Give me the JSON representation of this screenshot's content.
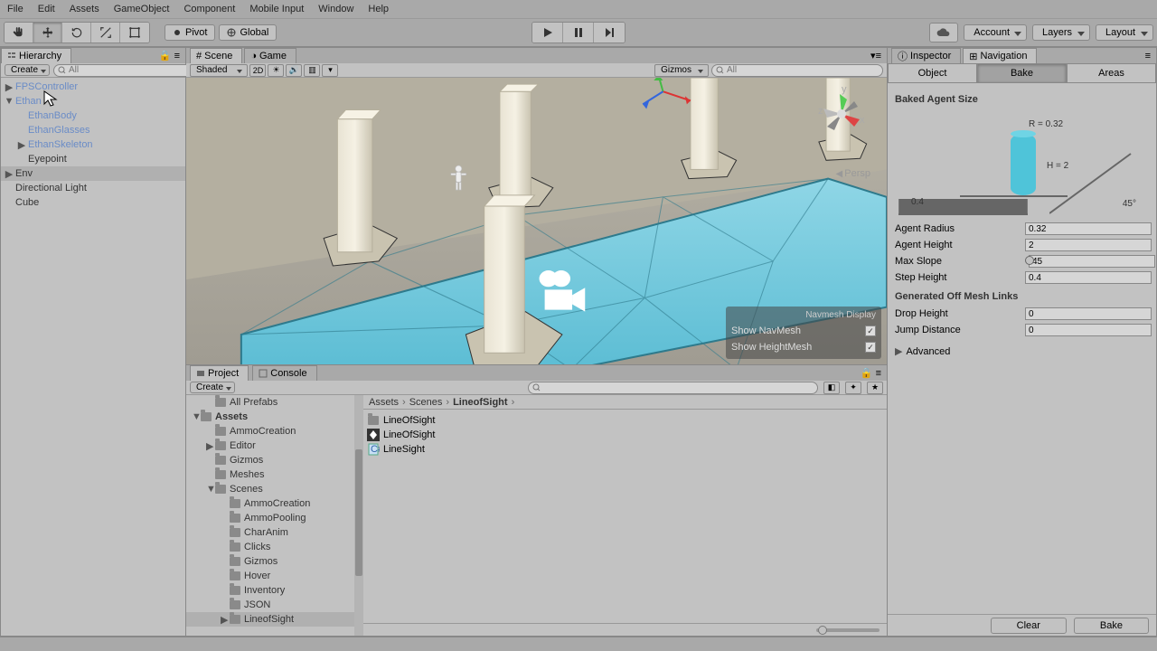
{
  "menu": {
    "items": [
      "File",
      "Edit",
      "Assets",
      "GameObject",
      "Component",
      "Mobile Input",
      "Window",
      "Help"
    ]
  },
  "toolbar": {
    "pivot": "Pivot",
    "global": "Global",
    "account": "Account",
    "layers": "Layers",
    "layout": "Layout"
  },
  "hierarchy": {
    "title": "Hierarchy",
    "create": "Create",
    "search_placeholder": "All",
    "items": [
      {
        "label": "FPSController",
        "indent": 0,
        "arrow": "▶",
        "color": "link"
      },
      {
        "label": "Ethan",
        "indent": 0,
        "arrow": "▼",
        "color": "link"
      },
      {
        "label": "EthanBody",
        "indent": 1,
        "color": "link"
      },
      {
        "label": "EthanGlasses",
        "indent": 1,
        "color": "link"
      },
      {
        "label": "EthanSkeleton",
        "indent": 1,
        "arrow": "▶",
        "color": "link"
      },
      {
        "label": "Eyepoint",
        "indent": 1,
        "plain": true
      },
      {
        "label": "Env",
        "indent": 0,
        "arrow": "▶",
        "selected": true,
        "plain": true
      },
      {
        "label": "Directional Light",
        "indent": 0,
        "plain": true
      },
      {
        "label": "Cube",
        "indent": 0,
        "plain": true
      }
    ]
  },
  "scene": {
    "tab_scene": "Scene",
    "tab_game": "Game",
    "shaded": "Shaded",
    "twod": "2D",
    "gizmos": "Gizmos",
    "search_placeholder": "All",
    "persp": "Persp",
    "navbox": {
      "title": "Navmesh Display",
      "show_navmesh": "Show NavMesh",
      "show_heightmesh": "Show HeightMesh"
    }
  },
  "project": {
    "tab_project": "Project",
    "tab_console": "Console",
    "create": "Create",
    "breadcrumb": [
      "Assets",
      "Scenes",
      "LineofSight"
    ],
    "folders": [
      {
        "label": "All Prefabs",
        "indent": 1
      },
      {
        "label": "Assets",
        "indent": 0,
        "bold": true,
        "arrow": "▼"
      },
      {
        "label": "AmmoCreation",
        "indent": 1
      },
      {
        "label": "Editor",
        "indent": 1,
        "arrow": "▶"
      },
      {
        "label": "Gizmos",
        "indent": 1
      },
      {
        "label": "Meshes",
        "indent": 1
      },
      {
        "label": "Scenes",
        "indent": 1,
        "arrow": "▼"
      },
      {
        "label": "AmmoCreation",
        "indent": 2
      },
      {
        "label": "AmmoPooling",
        "indent": 2
      },
      {
        "label": "CharAnim",
        "indent": 2
      },
      {
        "label": "Clicks",
        "indent": 2
      },
      {
        "label": "Gizmos",
        "indent": 2
      },
      {
        "label": "Hover",
        "indent": 2
      },
      {
        "label": "Inventory",
        "indent": 2
      },
      {
        "label": "JSON",
        "indent": 2
      },
      {
        "label": "LineofSight",
        "indent": 2,
        "selected": true,
        "arrow": "▶"
      }
    ],
    "assets": [
      {
        "label": "LineOfSight",
        "icon": "folder"
      },
      {
        "label": "LineOfSight",
        "icon": "unity"
      },
      {
        "label": "LineSight",
        "icon": "script"
      }
    ]
  },
  "inspector": {
    "tab_inspector": "Inspector",
    "tab_navigation": "Navigation",
    "subtabs": {
      "object": "Object",
      "bake": "Bake",
      "areas": "Areas"
    },
    "section_baked": "Baked Agent Size",
    "diagram": {
      "r": "R = 0.32",
      "h": "H = 2",
      "step": "0.4",
      "slope": "45°"
    },
    "props": {
      "agent_radius": {
        "label": "Agent Radius",
        "value": "0.32"
      },
      "agent_height": {
        "label": "Agent Height",
        "value": "2"
      },
      "max_slope": {
        "label": "Max Slope",
        "value": "45"
      },
      "step_height": {
        "label": "Step Height",
        "value": "0.4"
      }
    },
    "section_links": "Generated Off Mesh Links",
    "drop_height": {
      "label": "Drop Height",
      "value": "0"
    },
    "jump_distance": {
      "label": "Jump Distance",
      "value": "0"
    },
    "advanced": "Advanced",
    "clear": "Clear",
    "bake": "Bake"
  }
}
